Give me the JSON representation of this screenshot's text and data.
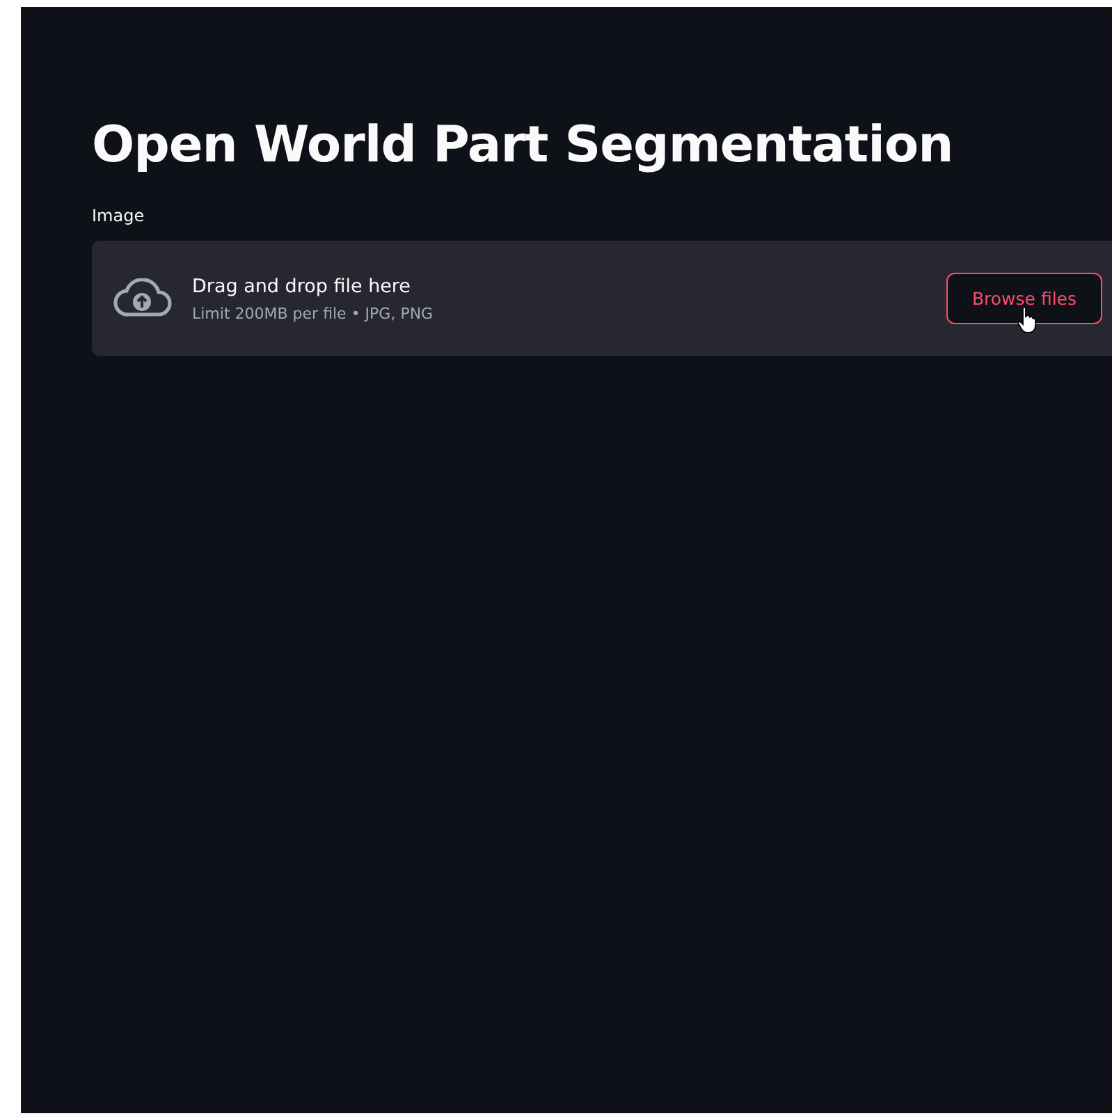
{
  "title": "Open World Part Segmentation",
  "uploader": {
    "label": "Image",
    "instructions": "Drag and drop file here",
    "limits": "Limit 200MB per file • JPG, PNG",
    "button": "Browse files"
  }
}
